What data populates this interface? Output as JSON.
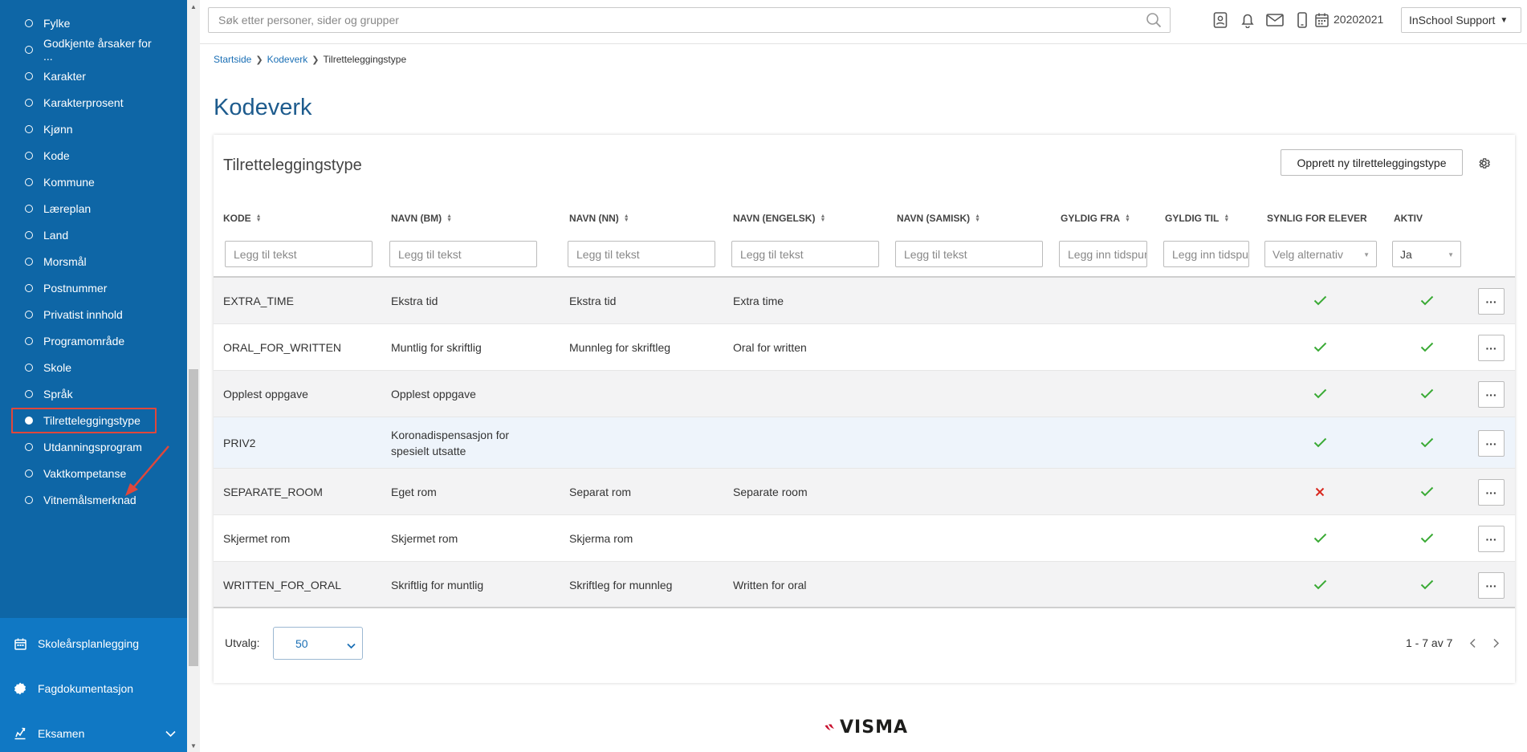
{
  "sidebar": {
    "sub_items": [
      {
        "label": "Fylke"
      },
      {
        "label": "Godkjente årsaker for ..."
      },
      {
        "label": "Karakter"
      },
      {
        "label": "Karakterprosent"
      },
      {
        "label": "Kjønn"
      },
      {
        "label": "Kode"
      },
      {
        "label": "Kommune"
      },
      {
        "label": "Læreplan"
      },
      {
        "label": "Land"
      },
      {
        "label": "Morsmål"
      },
      {
        "label": "Postnummer"
      },
      {
        "label": "Privatist innhold"
      },
      {
        "label": "Programområde"
      },
      {
        "label": "Skole"
      },
      {
        "label": "Språk"
      },
      {
        "label": "Tilretteleggingstype",
        "active": true
      },
      {
        "label": "Utdanningsprogram"
      },
      {
        "label": "Vaktkompetanse"
      },
      {
        "label": "Vitnemålsmerknad"
      }
    ],
    "main_items": [
      {
        "label": "Skoleårsplanlegging",
        "icon": "calendar-icon"
      },
      {
        "label": "Fagdokumentasjon",
        "icon": "badge-icon"
      },
      {
        "label": "Eksamen",
        "icon": "exam-icon",
        "has_chevron": true
      }
    ],
    "bg_color": "#0e66a6",
    "main_bg_color": "#1078c4",
    "highlight_color": "#e0473b"
  },
  "header": {
    "search_placeholder": "Søk etter personer, sider og grupper",
    "icons": [
      "contacts-icon",
      "bell-icon",
      "mail-icon",
      "phone-icon",
      "calendar-icon"
    ],
    "school_year": "20202021",
    "user": "InSchool Support"
  },
  "breadcrumb": {
    "items": [
      "Startside",
      "Kodeverk"
    ],
    "current": "Tilretteleggingstype"
  },
  "page": {
    "title": "Kodeverk"
  },
  "card": {
    "title": "Tilretteleggingstype",
    "create_button": "Opprett ny tilretteleggingstype",
    "columns": [
      {
        "label": "KODE",
        "sortable": true
      },
      {
        "label": "NAVN (BM)",
        "sortable": true
      },
      {
        "label": "NAVN (NN)",
        "sortable": true
      },
      {
        "label": "NAVN (ENGELSK)",
        "sortable": true
      },
      {
        "label": "NAVN (SAMISK)",
        "sortable": true
      },
      {
        "label": "GYLDIG FRA",
        "sortable": true
      },
      {
        "label": "GYLDIG TIL",
        "sortable": true
      },
      {
        "label": "SYNLIG FOR ELEVER",
        "sortable": false
      },
      {
        "label": "AKTIV",
        "sortable": false
      }
    ],
    "filters": {
      "text_placeholder": "Legg til tekst",
      "date_placeholder": "Legg inn tidspunkt",
      "select_placeholder": "Velg alternativ",
      "aktiv_value": "Ja"
    },
    "rows": [
      {
        "kode": "EXTRA_TIME",
        "bm": "Ekstra tid",
        "nn": "Ekstra tid",
        "en": "Extra time",
        "se": "",
        "fra": "",
        "til": "",
        "synlig": true,
        "aktiv": true
      },
      {
        "kode": "ORAL_FOR_WRITTEN",
        "bm": "Muntlig for skriftlig",
        "nn": "Munnleg for skriftleg",
        "en": "Oral for written",
        "se": "",
        "fra": "",
        "til": "",
        "synlig": true,
        "aktiv": true
      },
      {
        "kode": "Opplest oppgave",
        "bm": "Opplest oppgave",
        "nn": "",
        "en": "",
        "se": "",
        "fra": "",
        "til": "",
        "synlig": true,
        "aktiv": true
      },
      {
        "kode": "PRIV2",
        "bm": "Koronadispensasjon for spesielt utsatte",
        "nn": "",
        "en": "",
        "se": "",
        "fra": "",
        "til": "",
        "synlig": true,
        "aktiv": true
      },
      {
        "kode": "SEPARATE_ROOM",
        "bm": "Eget rom",
        "nn": "Separat rom",
        "en": "Separate room",
        "se": "",
        "fra": "",
        "til": "",
        "synlig": false,
        "aktiv": true
      },
      {
        "kode": "Skjermet rom",
        "bm": "Skjermet rom",
        "nn": "Skjerma rom",
        "en": "",
        "se": "",
        "fra": "",
        "til": "",
        "synlig": true,
        "aktiv": true
      },
      {
        "kode": "WRITTEN_FOR_ORAL",
        "bm": "Skriftlig for muntlig",
        "nn": "Skriftleg for munnleg",
        "en": "Written for oral",
        "se": "",
        "fra": "",
        "til": "",
        "synlig": true,
        "aktiv": true
      }
    ],
    "more_button_label": "···",
    "utvalg_label": "Utvalg:",
    "page_size": "50",
    "pager_text": "1 - 7 av 7"
  },
  "footer": {
    "logo_text": "VISMA"
  },
  "colors": {
    "check": "#3aaa35",
    "cross": "#d9281f",
    "title": "#1d5b8d",
    "link": "#1a6fb5"
  }
}
